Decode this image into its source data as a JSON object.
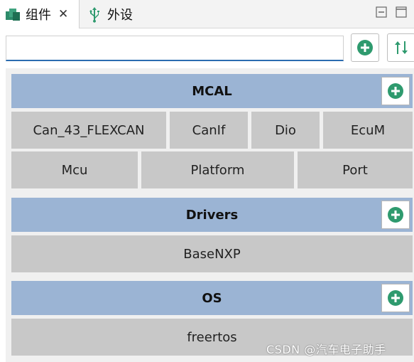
{
  "tabs": [
    {
      "label": "组件",
      "icon": "components-icon",
      "active": true
    },
    {
      "label": "外设",
      "icon": "usb-icon",
      "active": false
    }
  ],
  "search": {
    "value": "",
    "placeholder": ""
  },
  "colors": {
    "accent": "#2b6cb0",
    "header_bg": "#9bb4d4",
    "module_bg": "#c8c8c8",
    "plus_green": "#2e9a6e",
    "panel_bg": "#f0f0f0"
  },
  "categories": [
    {
      "name": "MCAL",
      "modules": [
        "Can_43_FLEXCAN",
        "CanIf",
        "Dio",
        "EcuM",
        "Mcu",
        "Platform",
        "Port"
      ]
    },
    {
      "name": "Drivers",
      "modules": [
        "BaseNXP"
      ]
    },
    {
      "name": "OS",
      "modules": [
        "freertos"
      ]
    }
  ],
  "watermark": "CSDN @汽车电子助手"
}
